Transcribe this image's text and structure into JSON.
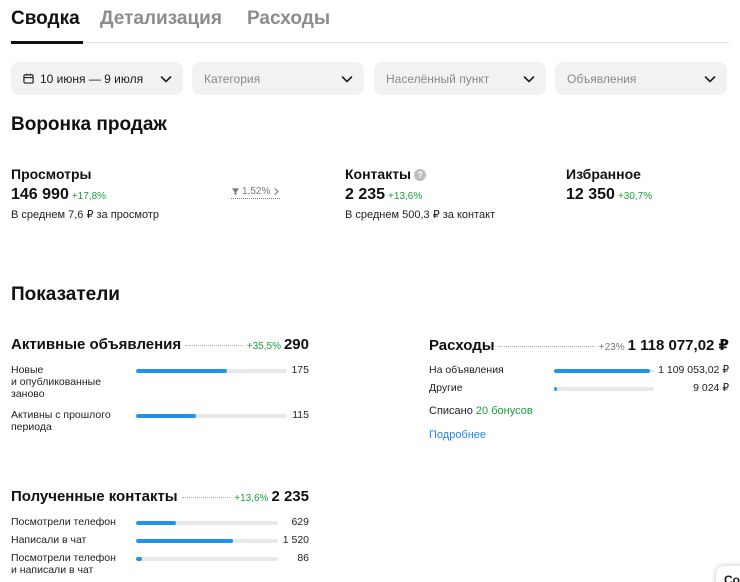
{
  "tabs": [
    {
      "label": "Сводка",
      "active": true
    },
    {
      "label": "Детализация",
      "active": false
    },
    {
      "label": "Расходы",
      "active": false
    }
  ],
  "filters": {
    "period": "10 июня — 9 июля",
    "category": "Категория",
    "locality": "Населённый пункт",
    "ads": "Объявления"
  },
  "funnel": {
    "title": "Воронка продаж",
    "views": {
      "label": "Просмотры",
      "value": "146 990",
      "delta": "+17,8%",
      "sub": "В среднем 7,6 ₽ за просмотр"
    },
    "conversion": "1,52%",
    "contacts": {
      "label": "Контакты",
      "help": "?",
      "value": "2 235",
      "delta": "+13,6%",
      "sub": "В среднем 500,3 ₽ за контакт"
    },
    "favorites": {
      "label": "Избранное",
      "value": "12 350",
      "delta": "+30,7%"
    }
  },
  "indicators": {
    "title": "Показатели",
    "active_ads": {
      "title": "Активные объявления",
      "delta": "+35,5%",
      "value": "290",
      "rows": [
        {
          "label": "Новые\nи опубликованные\nзаново",
          "value": "175",
          "fill": 0.6
        },
        {
          "label": "Активны с прошлого\nпериода",
          "value": "115",
          "fill": 0.4
        }
      ]
    },
    "expenses": {
      "title": "Расходы",
      "delta": "+23%",
      "value": "1 118 077,02 ₽",
      "rows": [
        {
          "label": "На объявления",
          "value": "1 109 053,02 ₽",
          "fill": 0.96
        },
        {
          "label": "Другие",
          "value": "9 024 ₽",
          "fill": 0.03
        }
      ],
      "spent_prefix": "Списано",
      "spent_bonus": "20 бонусов",
      "more_link": "Подробнее"
    },
    "received_contacts": {
      "title": "Полученные контакты",
      "delta": "+13,6%",
      "value": "2 235",
      "rows": [
        {
          "label": "Посмотрели телефон",
          "value": "629",
          "fill": 0.28
        },
        {
          "label": "Написали в чат",
          "value": "1 520",
          "fill": 0.68
        },
        {
          "label": "Посмотрели телефон\nи написали в чат",
          "value": "86",
          "fill": 0.04
        }
      ]
    }
  },
  "corner_chip": "Co",
  "colors": {
    "accent": "#1e95e8",
    "positive": "#1a9e3a",
    "link": "#1e88e5",
    "filter_bg": "#f2f2f2"
  }
}
